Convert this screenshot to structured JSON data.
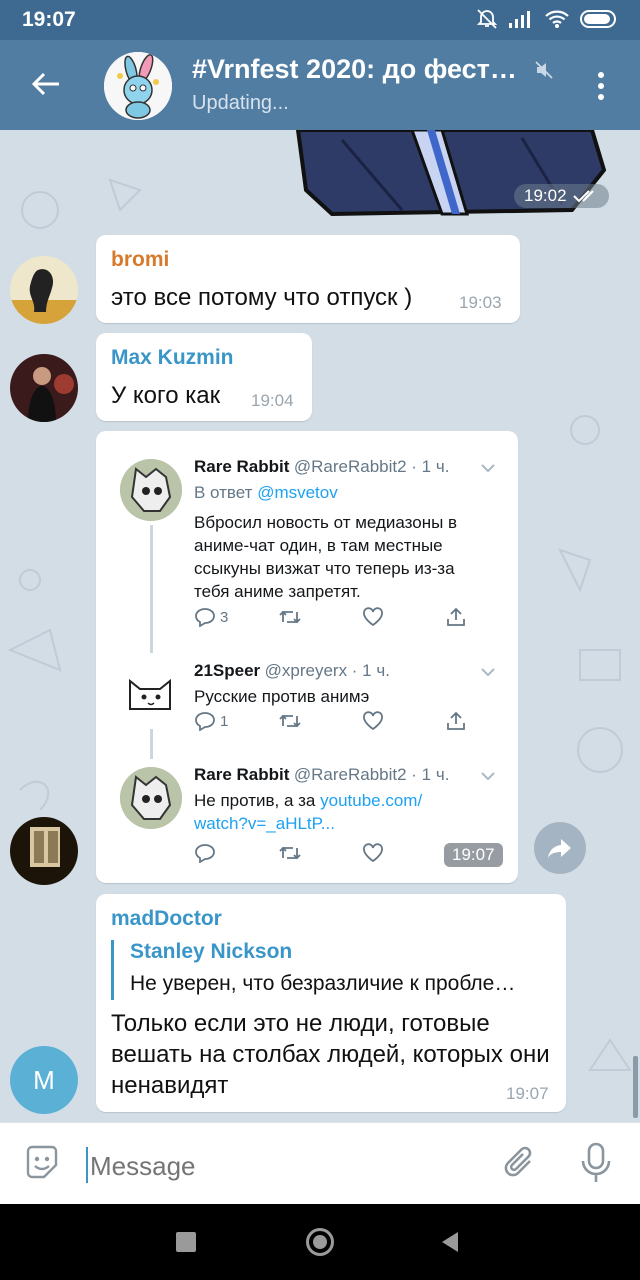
{
  "status": {
    "time": "19:07"
  },
  "header": {
    "title": "#Vrnfest 2020: до фест…",
    "subtitle": "Updating..."
  },
  "messages": {
    "sticker_time": "19:02",
    "bromi": {
      "sender": "bromi",
      "text": "это все потому что отпуск )",
      "time": "19:03"
    },
    "max": {
      "sender": "Max Kuzmin",
      "text": "У кого как",
      "time": "19:04"
    },
    "tweet_time": "19:07",
    "maddoctor": {
      "sender": "madDoctor",
      "reply_name": "Stanley Nickson",
      "reply_text": "Не уверен, что безразличие к пробле…",
      "text": "Только если это не люди, готовые вешать на столбах людей, которых они ненавидят",
      "time": "19:07",
      "avatar_letter": "M"
    }
  },
  "tweets": [
    {
      "name": "Rare Rabbit",
      "handle": "@RareRabbit2 · 1 ч.",
      "reply_prefix": "В ответ",
      "reply_to": "@msvetov",
      "body": "Вбросил новость от медиазоны в аниме-чат один, в там местные ссыкуны визжат что теперь из-за тебя аниме запретят.",
      "replies": "3"
    },
    {
      "name": "21Speer",
      "handle": "@xpreyerx · 1 ч.",
      "body": "Русские против анимэ",
      "replies": "1"
    },
    {
      "name": "Rare Rabbit",
      "handle": "@RareRabbit2 · 1 ч.",
      "body_prefix": "Не против, а за ",
      "link1": "youtube.com/",
      "link2": "watch?v=_aHLtP..."
    }
  ],
  "composer": {
    "placeholder": "Message"
  },
  "colors": {
    "app_bar": "#517da2",
    "sender_bromi": "#d87a2b",
    "sender_blue": "#3a95c8",
    "avatar_m": "#5bb0d6"
  }
}
